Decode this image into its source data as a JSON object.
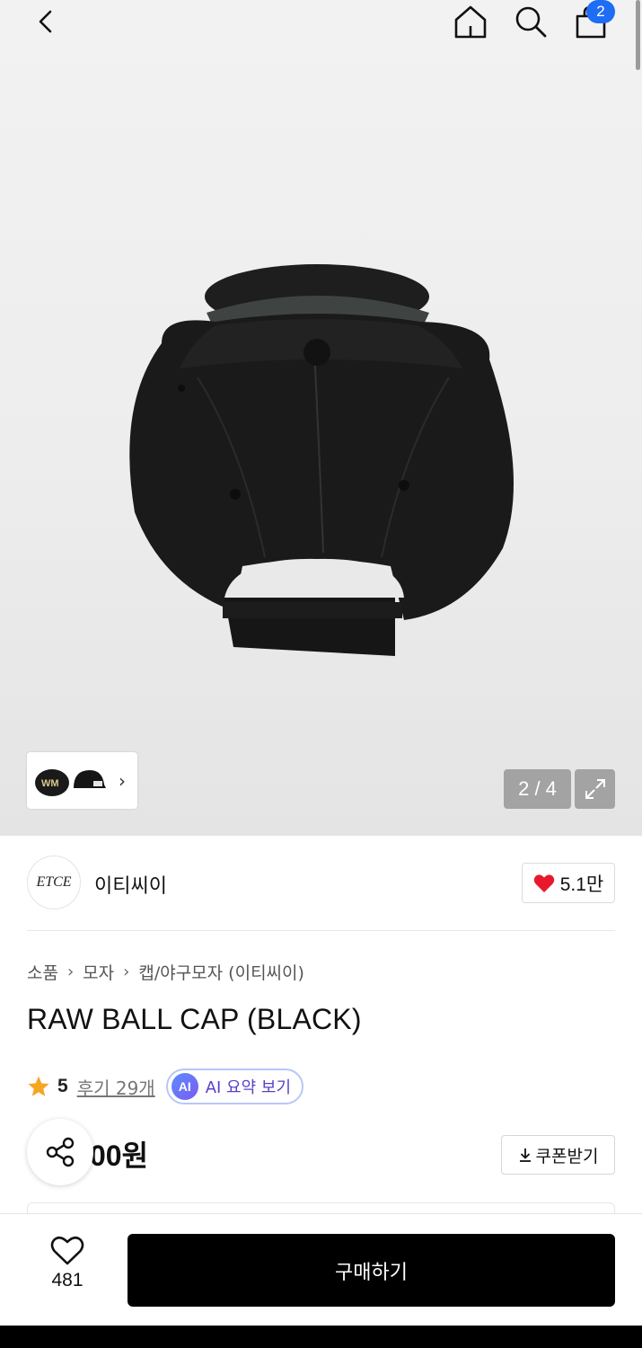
{
  "header": {
    "cart_count": "2",
    "icons": [
      "chevron-left-icon",
      "home-icon",
      "search-icon",
      "shopping-bag-icon"
    ]
  },
  "gallery": {
    "counter": "2 / 4",
    "thumbnail_arrow": "›"
  },
  "brand": {
    "logo_text": "ETCE",
    "name": "이티씨이",
    "like_count": "5.1만",
    "like_color": "#e8192c"
  },
  "product": {
    "breadcrumb": [
      "소품",
      "모자",
      "캡/야구모자 (이티씨이)"
    ],
    "breadcrumb_separator": "›",
    "title": "RAW BALL CAP (BLACK)",
    "rating": "5",
    "rating_color": "#f5a623",
    "reviews": "후기 29개",
    "ai_badge": "AI",
    "ai_summary": "AI 요약 보기",
    "price": "00원",
    "coupon": "쿠폰받기"
  },
  "bottom_bar": {
    "wish_count": "481",
    "buy_label": "구매하기"
  }
}
